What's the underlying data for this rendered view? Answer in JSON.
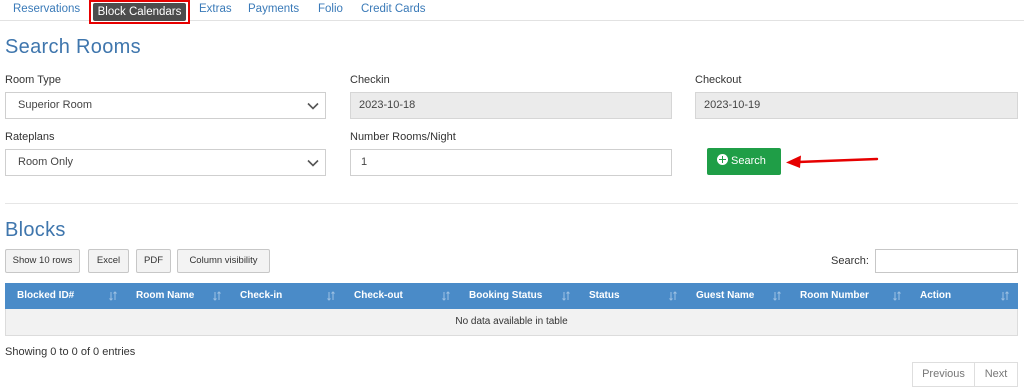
{
  "tabs": [
    {
      "label": "Reservations"
    },
    {
      "label": "Block Calendars"
    },
    {
      "label": "Extras"
    },
    {
      "label": "Payments"
    },
    {
      "label": "Folio"
    },
    {
      "label": "Credit Cards"
    }
  ],
  "search_rooms": {
    "title": "Search Rooms",
    "room_type_label": "Room Type",
    "room_type_value": "Superior Room",
    "checkin_label": "Checkin",
    "checkin_value": "2023-10-18",
    "checkout_label": "Checkout",
    "checkout_value": "2023-10-19",
    "rateplans_label": "Rateplans",
    "rateplans_value": "Room Only",
    "rooms_night_label": "Number Rooms/Night",
    "rooms_night_value": "1",
    "search_button": "Search"
  },
  "blocks": {
    "title": "Blocks",
    "buttons": [
      "Show 10 rows",
      "Excel",
      "PDF",
      "Column visibility"
    ],
    "search_label": "Search:",
    "columns": [
      "Blocked ID#",
      "Room Name",
      "Check-in",
      "Check-out",
      "Booking Status",
      "Status",
      "Guest Name",
      "Room Number",
      "Action"
    ],
    "empty_message": "No data available in table",
    "info": "Showing 0 to 0 of 0 entries",
    "pagination": {
      "previous": "Previous",
      "next": "Next"
    }
  },
  "colors": {
    "accent": "#3f76ad",
    "table_header": "#4a8bc8",
    "search_button": "#1f9e47",
    "highlight": "#e60000"
  }
}
